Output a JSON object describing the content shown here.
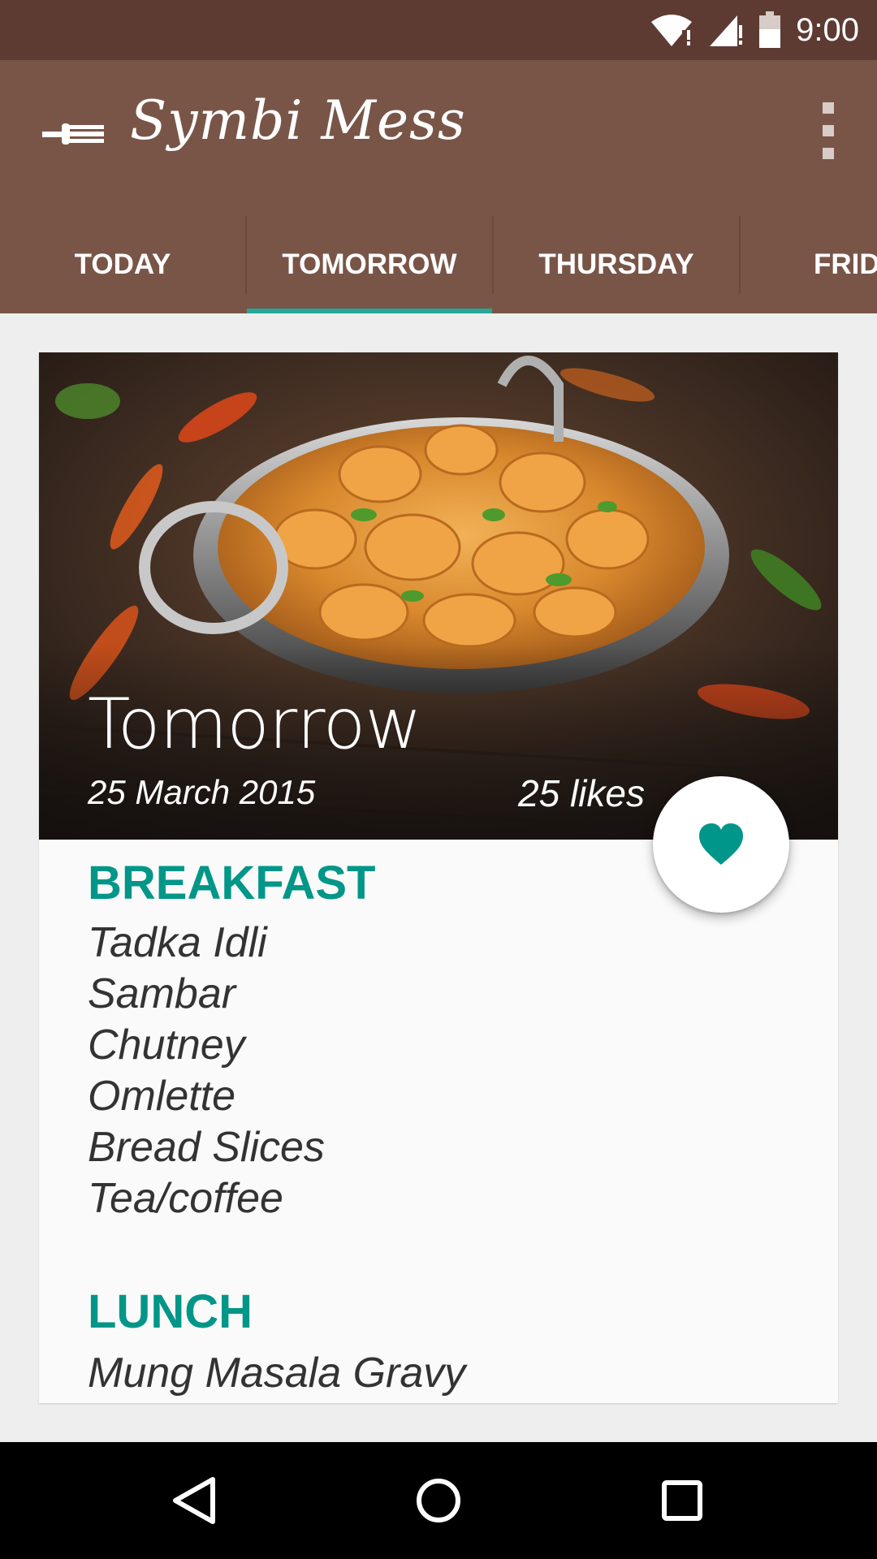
{
  "status_bar": {
    "time": "9:00",
    "icons": [
      "wifi-alert-icon",
      "signal-alert-icon",
      "battery-icon"
    ]
  },
  "app_bar": {
    "title": "Symbi Mess",
    "nav_icon": "fork-icon",
    "overflow_icon": "more-vert-icon"
  },
  "tabs": [
    {
      "label": "TODAY"
    },
    {
      "label": "TOMORROW",
      "selected": true
    },
    {
      "label": "THURSDAY"
    },
    {
      "label": "FRID"
    }
  ],
  "card": {
    "title": "Tomorrow",
    "date": "25 March 2015",
    "likes": "25 likes",
    "fab_icon": "heart-icon",
    "sections": [
      {
        "title": "BREAKFAST",
        "items": [
          "Tadka Idli",
          "Sambar",
          "Chutney",
          "Omlette",
          "Bread Slices",
          "Tea/coffee"
        ]
      },
      {
        "title": "LUNCH",
        "items": [
          "Mung Masala Gravy"
        ]
      }
    ]
  },
  "nav_bar": {
    "icons": [
      "back-icon",
      "home-icon",
      "recents-icon"
    ]
  },
  "colors": {
    "status_bar": "#5d3b33",
    "app_bar": "#795548",
    "accent": "#009688",
    "tab_indicator": "#26a69a"
  }
}
